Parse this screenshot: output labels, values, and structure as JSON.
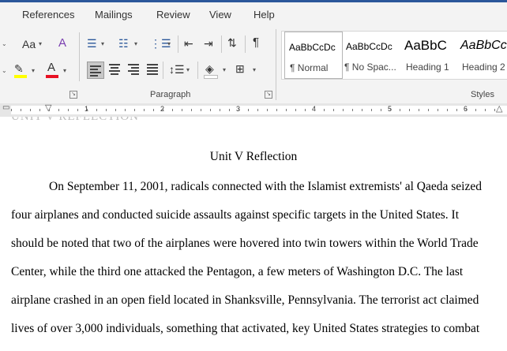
{
  "ribbon_tabs": [
    "References",
    "Mailings",
    "Review",
    "View",
    "Help"
  ],
  "groups": {
    "paragraph": "Paragraph",
    "styles": "Styles"
  },
  "font_controls": {
    "font_size_label": "Aa"
  },
  "styles": [
    {
      "sample": "AaBbCcDc",
      "name": "¶ Normal"
    },
    {
      "sample": "AaBbCcDc",
      "name": "¶ No Spac..."
    },
    {
      "sample": "AaBbC",
      "name": "Heading 1"
    },
    {
      "sample": "AaBbCc",
      "name": "Heading 2"
    }
  ],
  "ruler_numbers": [
    "1",
    "2",
    "3",
    "4",
    "5",
    "6"
  ],
  "colors": {
    "highlight": "#ffff00",
    "font_color": "#e81123",
    "accent": "#2b579a"
  },
  "document": {
    "header_text": "UNIT V REFLECTION",
    "title": "Unit V Reflection",
    "lines": [
      "On September 11, 2001, radicals connected with the Islamist extremists' al Qaeda seized",
      "four airplanes and conducted suicide assaults against specific targets in the United States. It",
      "should be noted that two of the airplanes were hovered into twin towers within the World Trade",
      "Center, while the third one attacked the Pentagon, a few meters of Washington D.C. The last",
      "airplane crashed in an open field located in Shanksville, Pennsylvania.  The terrorist act claimed",
      "lives of over 3,000 individuals, something that activated, key United States strategies to combat"
    ]
  }
}
